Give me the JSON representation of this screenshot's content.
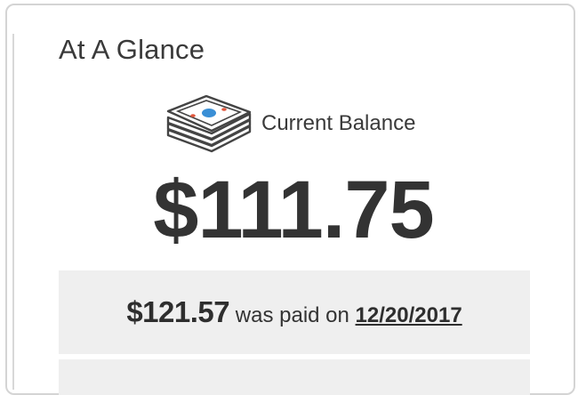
{
  "card": {
    "title": "At A Glance"
  },
  "balance": {
    "icon": "money-stack-icon",
    "label": "Current Balance",
    "amount": "$111.75"
  },
  "last_payment": {
    "amount": "$121.57",
    "connector": "was paid on",
    "date": "12/20/2017"
  },
  "colors": {
    "text": "#333333",
    "panel": "#efefef",
    "border": "#d4d4d4",
    "icon_red": "#e2583e",
    "icon_blue": "#3a8fd6"
  }
}
